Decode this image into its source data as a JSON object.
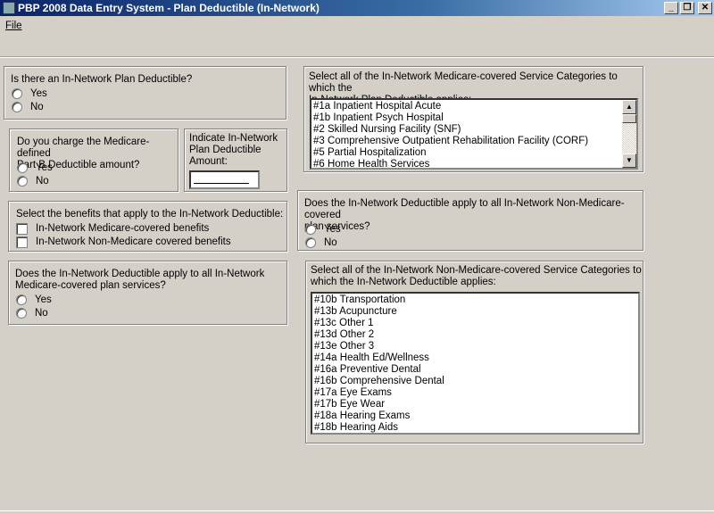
{
  "window": {
    "title": "PBP 2008 Data Entry System - Plan Deductible (In-Network)",
    "minimize": "_",
    "restore": "❐",
    "close": "✕"
  },
  "menu": {
    "file": "File"
  },
  "q_plan_deductible": {
    "label": "Is there an In-Network Plan Deductible?",
    "yes": "Yes",
    "no": "No"
  },
  "q_part_b": {
    "label_1": "Do you charge the Medicare-defined",
    "label_2": "Part B Deductible amount?",
    "yes": "Yes",
    "no": "No"
  },
  "amount": {
    "label_1": "Indicate In-Network",
    "label_2": "Plan Deductible",
    "label_3": "Amount:",
    "value": ""
  },
  "benefits": {
    "label": "Select the benefits that apply to the In-Network Deductible:",
    "options": [
      "In-Network Medicare-covered benefits",
      "In-Network Non-Medicare covered benefits"
    ]
  },
  "q_all_medicare": {
    "label_1": "Does the In-Network Deductible apply to all In-Network",
    "label_2": "Medicare-covered plan services?",
    "yes": "Yes",
    "no": "No"
  },
  "medicare_categories": {
    "label_1": "Select all of the In-Network Medicare-covered Service Categories to which the",
    "label_2": "In-Network Plan Deductible applies:",
    "items": [
      "#1a Inpatient Hospital Acute",
      "#1b Inpatient Psych Hospital",
      "#2 Skilled Nursing Facility (SNF)",
      "#3 Comprehensive Outpatient Rehabilitation Facility (CORF)",
      "#5 Partial Hospitalization",
      "#6 Home Health Services"
    ]
  },
  "q_all_non_medicare": {
    "label_1": "Does the In-Network Deductible apply to all In-Network Non-Medicare-covered",
    "label_2": "plan services?",
    "yes": "Yes",
    "no": "No"
  },
  "non_medicare_categories": {
    "label_1": "Select all of the In-Network Non-Medicare-covered Service Categories to",
    "label_2": "which the In-Network Deductible applies:",
    "items": [
      "#10b Transportation",
      "#13b Acupuncture",
      "#13c Other 1",
      "#13d Other 2",
      "#13e Other 3",
      "#14a Health Ed/Wellness",
      "#16a Preventive Dental",
      "#16b Comprehensive Dental",
      "#17a Eye Exams",
      "#17b Eye Wear",
      "#18a Hearing Exams",
      "#18b Hearing Aids"
    ]
  }
}
